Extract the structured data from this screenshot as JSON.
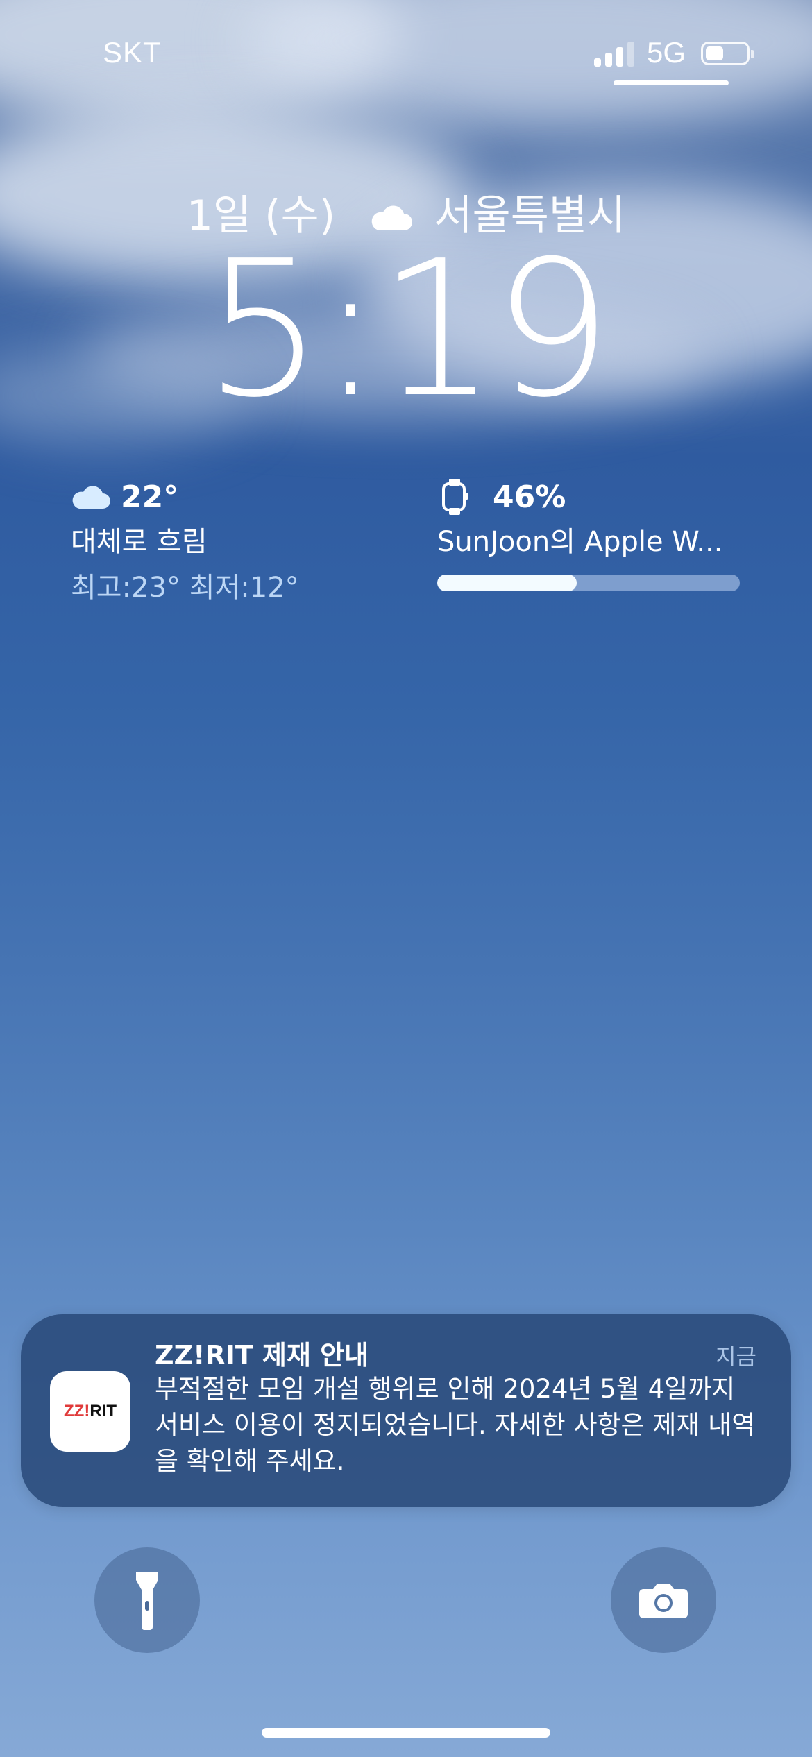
{
  "status_bar": {
    "carrier": "SKT",
    "network": "5G",
    "signal_bars_active": 3,
    "signal_bars_total": 4,
    "battery_level": 0.45
  },
  "lock_screen": {
    "date": "1일 (수)",
    "location": "서울특별시",
    "time": "5:19"
  },
  "weather_widget": {
    "icon": "cloud-icon",
    "temperature": "22°",
    "condition": "대체로 흐림",
    "high_low": "최고:23° 최저:12°"
  },
  "watch_widget": {
    "icon": "apple-watch-icon",
    "battery_percent": "46%",
    "battery_fraction": 0.46,
    "device_name": "SunJoon의 Apple W..."
  },
  "notification": {
    "app_icon_text_red": "ZZ!",
    "app_icon_text_black": "RIT",
    "title": "ZZ!RIT 제재 안내",
    "time": "지금",
    "body": "부적절한 모임 개설 행위로 인해 2024년 5월 4일까지 서비스 이용이 정지되었습니다. 자세한 사항은 제재 내역을 확인해 주세요."
  },
  "quick_actions": {
    "left": "flashlight-icon",
    "right": "camera-icon"
  },
  "colors": {
    "notification_bg": "#284878",
    "hilo_text": "#bcd6f5",
    "brand_red": "#e03a3a"
  }
}
